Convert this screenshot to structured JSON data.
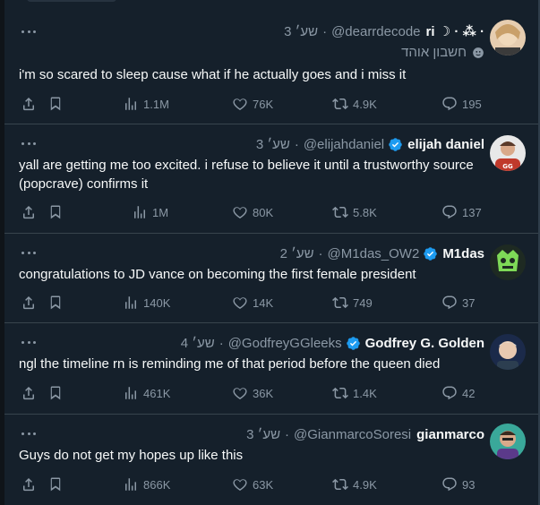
{
  "tweets": [
    {
      "name": "ri ☽ · ⁂ ·",
      "handle": "@dearrdecode",
      "time": "3 שע׳",
      "verified": false,
      "subline": "חשבון אוהד",
      "subline_icon": "theater-masks-icon",
      "text": "i'm so scared to sleep cause what if he actually goes and i miss it",
      "views": "1.1M",
      "likes": "76K",
      "retweets": "4.9K",
      "replies": "195",
      "avatar_color": "#c9a88a"
    },
    {
      "name": "elijah daniel",
      "handle": "@elijahdaniel",
      "time": "3 שע׳",
      "verified": true,
      "subline": "",
      "text": "yall are getting me too excited. i refuse to believe it until a trustworthy source (popcrave) confirms it",
      "views": "1M",
      "likes": "80K",
      "retweets": "5.8K",
      "replies": "137",
      "avatar_color": "#c0392b"
    },
    {
      "name": "M1das",
      "handle": "@M1das_OW2",
      "time": "2 שע׳",
      "verified": true,
      "subline": "",
      "text": "congratulations to JD vance on becoming the first female president",
      "views": "140K",
      "likes": "14K",
      "retweets": "749",
      "replies": "37",
      "avatar_color": "#2a3a2a"
    },
    {
      "name": "Godfrey G. Golden",
      "handle": "@GodfreyGGleeks",
      "time": "4 שע׳",
      "verified": true,
      "subline": "",
      "text": "ngl the timeline rn is reminding me of that period before the queen died",
      "views": "461K",
      "likes": "36K",
      "retweets": "1.4K",
      "replies": "42",
      "avatar_color": "#1b2a4a"
    },
    {
      "name": "gianmarco",
      "handle": "@GianmarcoSoresi",
      "time": "3 שע׳",
      "verified": false,
      "subline": "",
      "text": "Guys do not get my hopes up like this",
      "views": "866K",
      "likes": "63K",
      "retweets": "4.9K",
      "replies": "93",
      "avatar_color": "#3aa89a"
    }
  ],
  "colors": {
    "background": "#15202b",
    "divider": "#38444d",
    "secondary_text": "#8b98a5",
    "verified": "#1d9bf0"
  }
}
